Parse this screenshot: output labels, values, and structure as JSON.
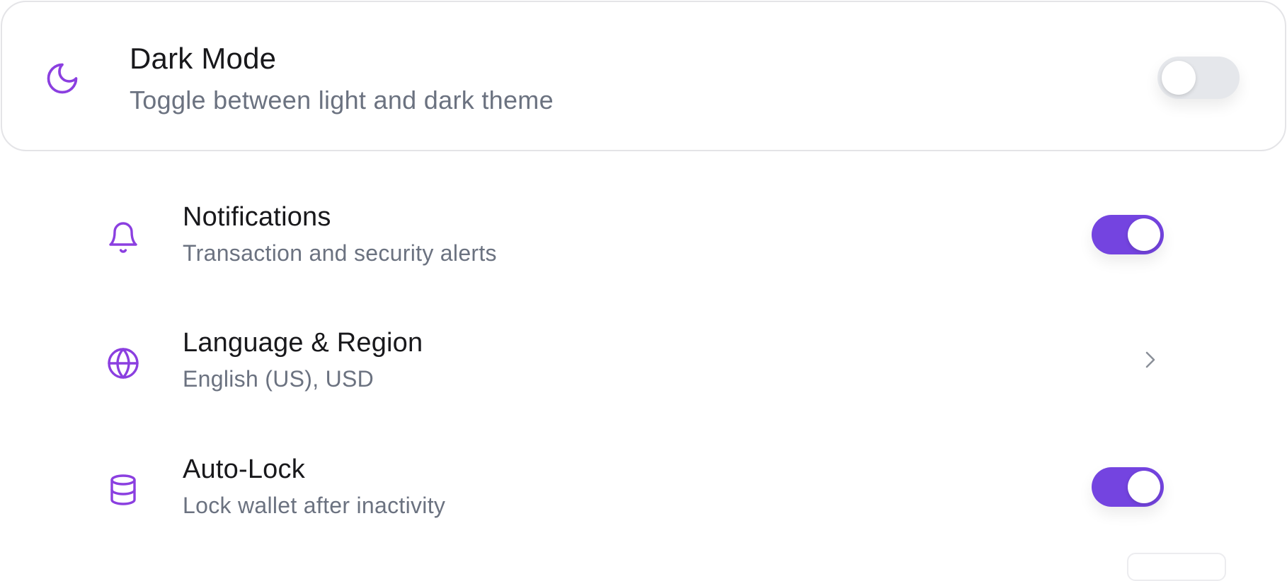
{
  "dark_mode": {
    "title": "Dark Mode",
    "subtitle": "Toggle between light and dark theme",
    "enabled": false,
    "icon": "moon-icon"
  },
  "settings": [
    {
      "title": "Notifications",
      "subtitle": "Transaction and security alerts",
      "icon": "bell-icon",
      "control": "toggle",
      "enabled": true
    },
    {
      "title": "Language & Region",
      "subtitle": "English (US), USD",
      "icon": "globe-icon",
      "control": "chevron"
    },
    {
      "title": "Auto-Lock",
      "subtitle": "Lock wallet after inactivity",
      "icon": "database-icon",
      "control": "toggle",
      "enabled": true
    }
  ],
  "colors": {
    "accent": "#7444E0",
    "icon_purple": "#8B3FE0",
    "title_text": "#18181B",
    "subtitle_text": "#6B7280",
    "toggle_off": "#E5E7EB",
    "border": "#E4E4E7"
  }
}
